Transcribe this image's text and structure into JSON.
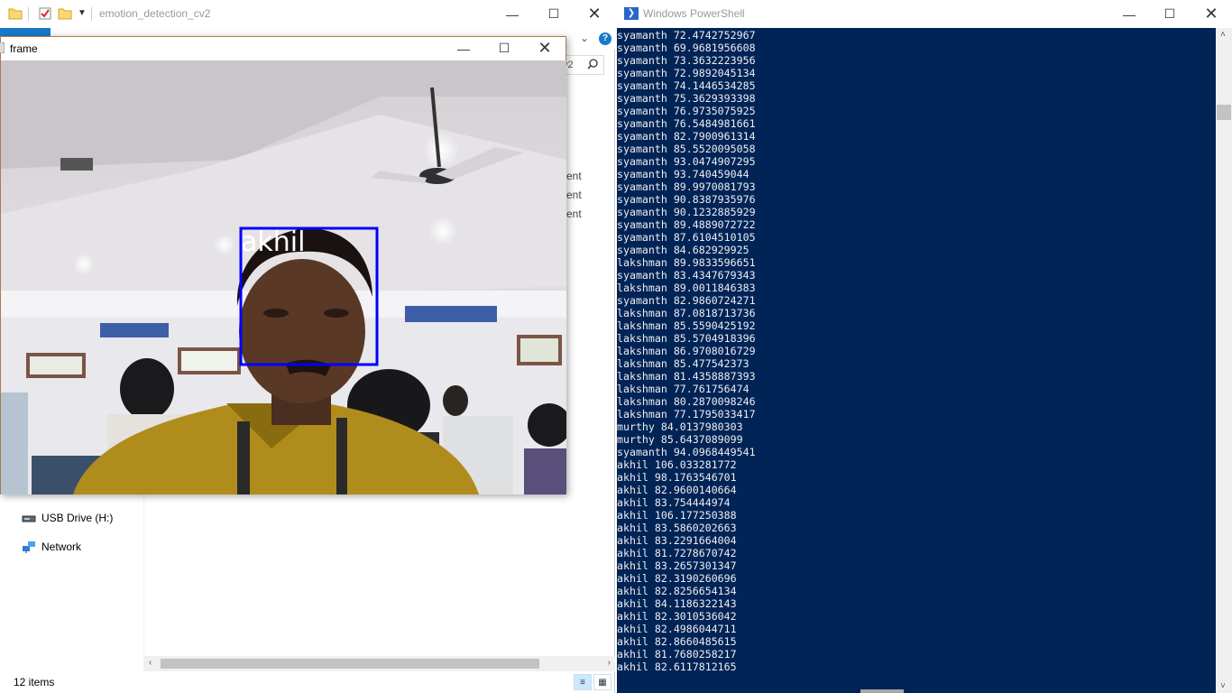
{
  "explorer": {
    "title": "emotion_detection_cv2",
    "search_text": "v2",
    "nav_items": [
      {
        "label": "USB Drive (H:)",
        "icon": "usb-drive-icon"
      },
      {
        "label": "Network",
        "icon": "network-icon"
      }
    ],
    "type_fragments": [
      "ent",
      "ent",
      "ent"
    ],
    "status": "12 items",
    "accent_color": "#1979ca"
  },
  "frame": {
    "title": "frame",
    "face_label": "akhil",
    "box_color": "#0000ff"
  },
  "powershell": {
    "title": "Windows PowerShell",
    "background_color": "#012456",
    "lines": [
      "syamanth 72.4742752967",
      "syamanth 69.9681956608",
      "syamanth 73.3632223956",
      "syamanth 72.9892045134",
      "syamanth 74.1446534285",
      "syamanth 75.3629393398",
      "syamanth 76.9735075925",
      "syamanth 76.5484981661",
      "syamanth 82.7900961314",
      "syamanth 85.5520095058",
      "syamanth 93.0474907295",
      "syamanth 93.740459044",
      "syamanth 89.9970081793",
      "syamanth 90.8387935976",
      "syamanth 90.1232885929",
      "syamanth 89.4889072722",
      "syamanth 87.6104510105",
      "syamanth 84.682929925",
      "lakshman 89.9833596651",
      "syamanth 83.4347679343",
      "lakshman 89.0011846383",
      "syamanth 82.9860724271",
      "lakshman 87.0818713736",
      "lakshman 85.5590425192",
      "lakshman 85.5704918396",
      "lakshman 86.9708016729",
      "lakshman 85.477542373",
      "lakshman 81.4358887393",
      "lakshman 77.761756474",
      "lakshman 80.2870098246",
      "lakshman 77.1795033417",
      "murthy 84.0137980303",
      "murthy 85.6437089099",
      "syamanth 94.0968449541",
      "akhil 106.033281772",
      "akhil 98.1763546701",
      "akhil 82.9600140664",
      "akhil 83.754444974",
      "akhil 106.177250388",
      "akhil 83.5860202663",
      "akhil 83.2291664004",
      "akhil 81.7278670742",
      "akhil 83.2657301347",
      "akhil 82.3190260696",
      "akhil 82.8256654134",
      "akhil 84.1186322143",
      "akhil 82.3010536042",
      "akhil 82.4986044711",
      "akhil 82.8660485615",
      "akhil 81.7680258217",
      "akhil 82.6117812165"
    ]
  }
}
